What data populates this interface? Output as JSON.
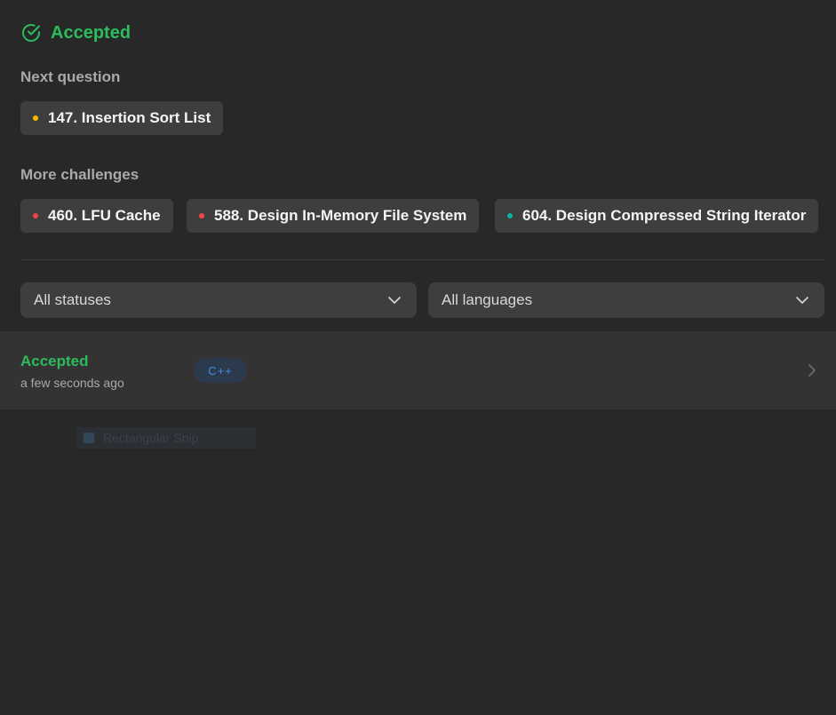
{
  "result": {
    "title": "Accepted",
    "color": "#2cbb5d",
    "icon": "check-circle-icon"
  },
  "next_question": {
    "label": "Next question",
    "item": {
      "title": "147. Insertion Sort List",
      "difficulty_color": "#ffb800"
    }
  },
  "more_challenges": {
    "label": "More challenges",
    "items": [
      {
        "title": "460. LFU Cache",
        "difficulty_color": "#ef4743"
      },
      {
        "title": "588. Design In-Memory File System",
        "difficulty_color": "#ef4743"
      },
      {
        "title": "604. Design Compressed String Iterator",
        "difficulty_color": "#00b8a3"
      }
    ]
  },
  "filters": {
    "status": {
      "value": "All statuses",
      "icon": "chevron-down-icon"
    },
    "language": {
      "value": "All languages",
      "icon": "chevron-down-icon"
    }
  },
  "submissions": [
    {
      "status": "Accepted",
      "time": "a few seconds ago",
      "language": "C++",
      "icon": "chevron-right-icon"
    }
  ],
  "overlay": {
    "snip_label": "Rectangular Snip"
  }
}
